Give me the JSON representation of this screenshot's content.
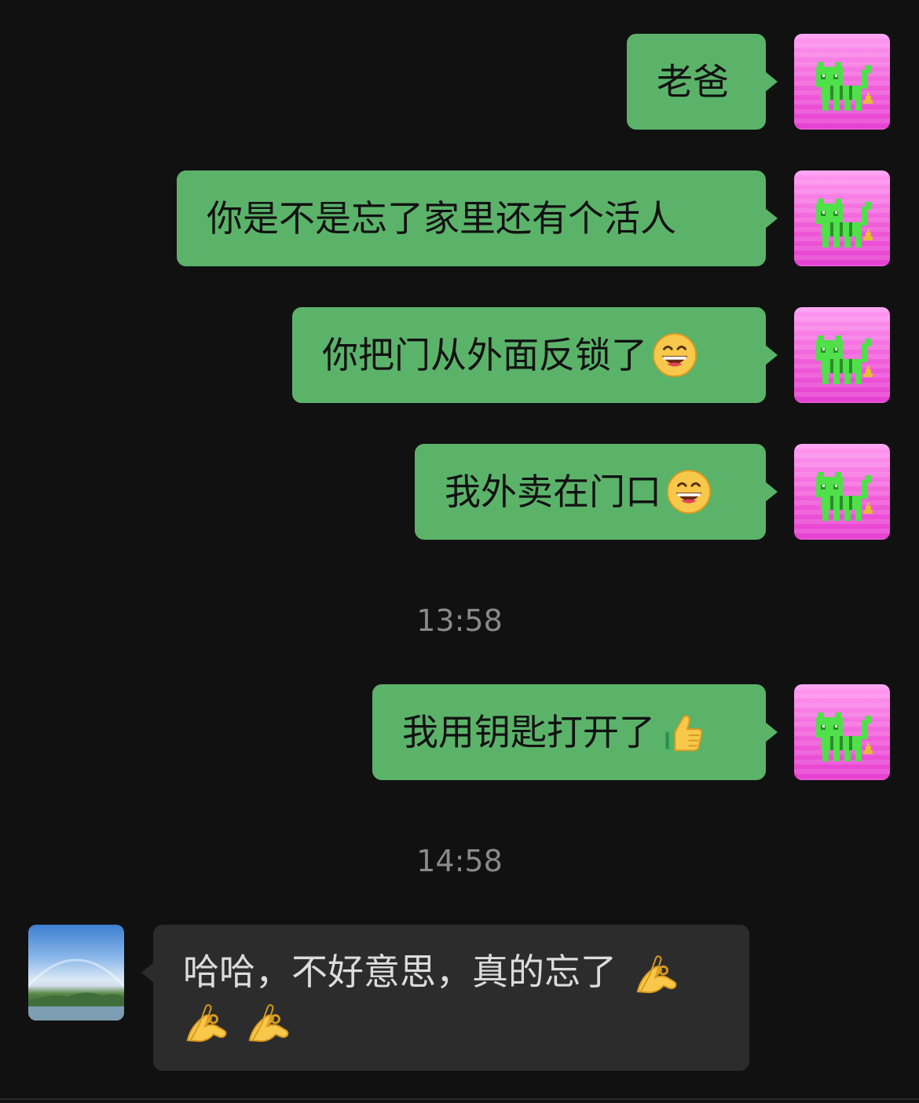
{
  "messages": [
    {
      "text": "老爸",
      "emoji": ""
    },
    {
      "text": "你是不是忘了家里还有个活人",
      "emoji": ""
    },
    {
      "text": "你把门从外面反锁了",
      "emoji": "grinning-face"
    },
    {
      "text": "我外卖在门口",
      "emoji": "grinning-face"
    },
    {
      "text": "我用钥匙打开了",
      "emoji": "thumbs-up"
    }
  ],
  "timestamps": [
    "13:58",
    "14:58"
  ],
  "reply": {
    "text": "哈哈，不好意思，真的忘了",
    "emoji": "ok-hand"
  },
  "avatars": {
    "self": "pixel-cat-icon",
    "other": "landscape-rainbow-photo"
  },
  "colors": {
    "background": "#111111",
    "outgoing_bubble": "#5bb36a",
    "incoming_bubble": "#2c2c2c",
    "timestamp_text": "#8a8a8a"
  }
}
